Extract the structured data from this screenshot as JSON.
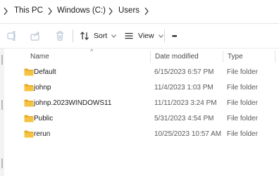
{
  "breadcrumb": {
    "items": [
      "This PC",
      "Windows (C:)",
      "Users"
    ]
  },
  "toolbar": {
    "sort_label": "Sort",
    "view_label": "View",
    "more_label": "•••"
  },
  "columns": {
    "name": "Name",
    "date": "Date modified",
    "type": "Type",
    "sort_indicator": "^"
  },
  "rows": [
    {
      "name": "Default",
      "date": "6/15/2023 6:57 PM",
      "type": "File folder"
    },
    {
      "name": "johnp",
      "date": "11/4/2023 1:03 PM",
      "type": "File folder"
    },
    {
      "name": "johnp.2023WINDOWS11",
      "date": "11/11/2023 3:24 PM",
      "type": "File folder"
    },
    {
      "name": "Public",
      "date": "5/31/2023 4:54 PM",
      "type": "File folder"
    },
    {
      "name": "rerun",
      "date": "10/25/2023 10:57 AM",
      "type": "File folder"
    }
  ],
  "colors": {
    "folder_fill": "#f5c342",
    "folder_back": "#e6a824"
  }
}
